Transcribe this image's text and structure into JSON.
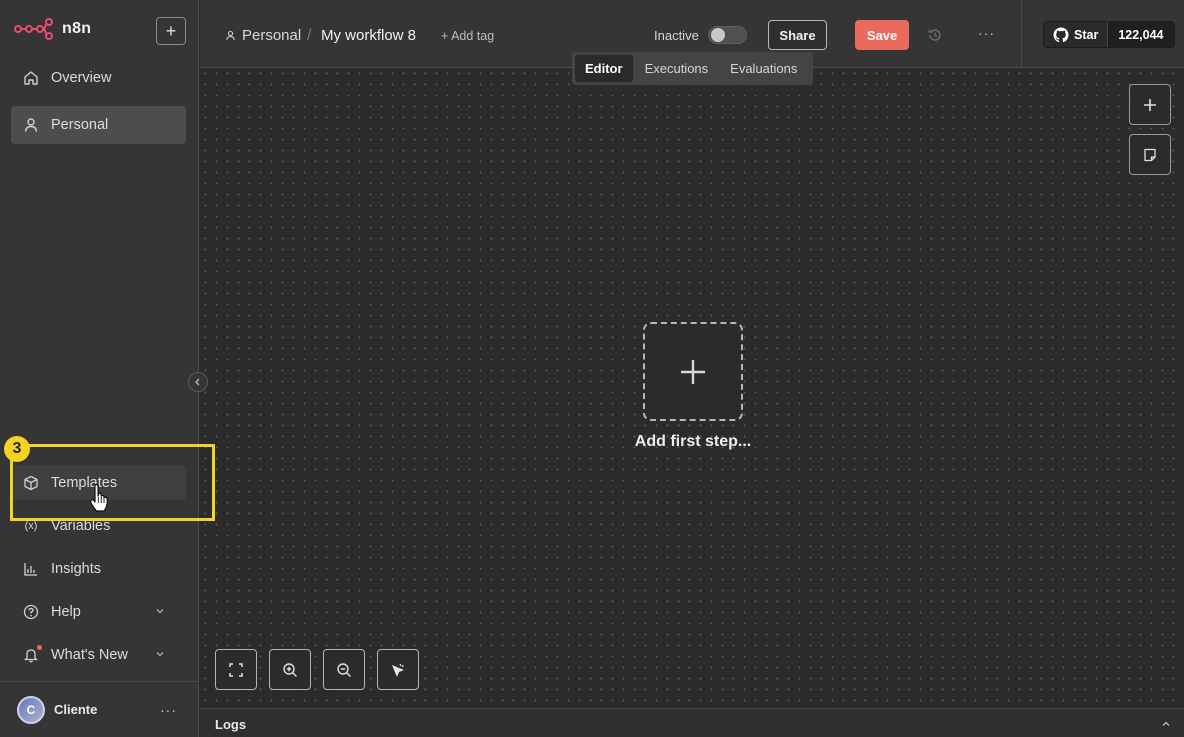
{
  "app": {
    "name": "n8n"
  },
  "sidebar": {
    "items": [
      {
        "label": "Overview"
      },
      {
        "label": "Personal"
      }
    ],
    "bottom_items": [
      {
        "label": "Templates"
      },
      {
        "label": "Variables"
      },
      {
        "label": "Insights"
      },
      {
        "label": "Help"
      },
      {
        "label": "What's New"
      }
    ],
    "user": {
      "initial": "C",
      "name": "Cliente",
      "menu": "···"
    }
  },
  "overlay": {
    "step_number": "3",
    "highlight_color": "#f2d424"
  },
  "header": {
    "breadcrumb_project": "Personal",
    "breadcrumb_sep": "/",
    "workflow_title": "My workflow 8",
    "add_tag": "+ Add tag",
    "status_label": "Inactive",
    "share_label": "Share",
    "save_label": "Save",
    "more_label": "···",
    "github_star": "Star",
    "github_count": "122,044"
  },
  "tabs": [
    {
      "label": "Editor",
      "active": true
    },
    {
      "label": "Executions",
      "active": false
    },
    {
      "label": "Evaluations",
      "active": false
    }
  ],
  "canvas": {
    "add_first_step": "Add first step..."
  },
  "logs": {
    "label": "Logs"
  },
  "colors": {
    "accent_save": "#ea6a5e",
    "sidebar_bg": "#353535",
    "canvas_bg": "#2b2b2b"
  }
}
